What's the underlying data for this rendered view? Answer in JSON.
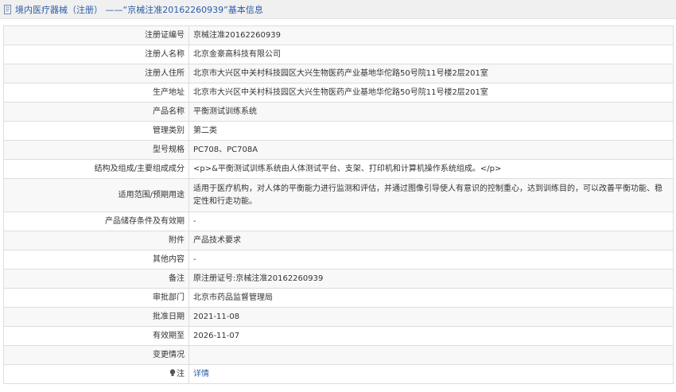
{
  "header": {
    "title": "境内医疗器械（注册） ——“京械注准20162260939”基本信息",
    "icon": "document-icon"
  },
  "rows": [
    {
      "label": "注册证编号",
      "value": "京械注准20162260939"
    },
    {
      "label": "注册人名称",
      "value": "北京金豪高科技有限公司"
    },
    {
      "label": "注册人住所",
      "value": "北京市大兴区中关村科技园区大兴生物医药产业基地华佗路50号院11号楼2层201室"
    },
    {
      "label": "生产地址",
      "value": "北京市大兴区中关村科技园区大兴生物医药产业基地华佗路50号院11号楼2层201室"
    },
    {
      "label": "产品名称",
      "value": "平衡测试训练系统"
    },
    {
      "label": "管理类别",
      "value": "第二类"
    },
    {
      "label": "型号规格",
      "value": "PC708、PC708A"
    },
    {
      "label": "结构及组成/主要组成成分",
      "value": "<p>&平衡测试训练系统由人体测试平台、支架、打印机和计算机操作系统组成。</p>"
    },
    {
      "label": "适用范围/预期用途",
      "value": "适用于医疗机构，对人体的平衡能力进行监测和评估，并通过图像引导使人有意识的控制重心，达到训练目的，可以改善平衡功能、稳定性和行走功能。"
    },
    {
      "label": "产品储存条件及有效期",
      "value": "-"
    },
    {
      "label": "附件",
      "value": "产品技术要求"
    },
    {
      "label": "其他内容",
      "value": "-"
    },
    {
      "label": "备注",
      "value": "原注册证号:京械注准20162260939"
    },
    {
      "label": "审批部门",
      "value": "北京市药品监督管理局"
    },
    {
      "label": "批准日期",
      "value": "2021-11-08"
    },
    {
      "label": "有效期至",
      "value": "2026-11-07"
    },
    {
      "label": "变更情况",
      "value": ""
    }
  ],
  "note_row": {
    "label": "注",
    "icon": "lightbulb-icon",
    "link_text": "详情"
  }
}
